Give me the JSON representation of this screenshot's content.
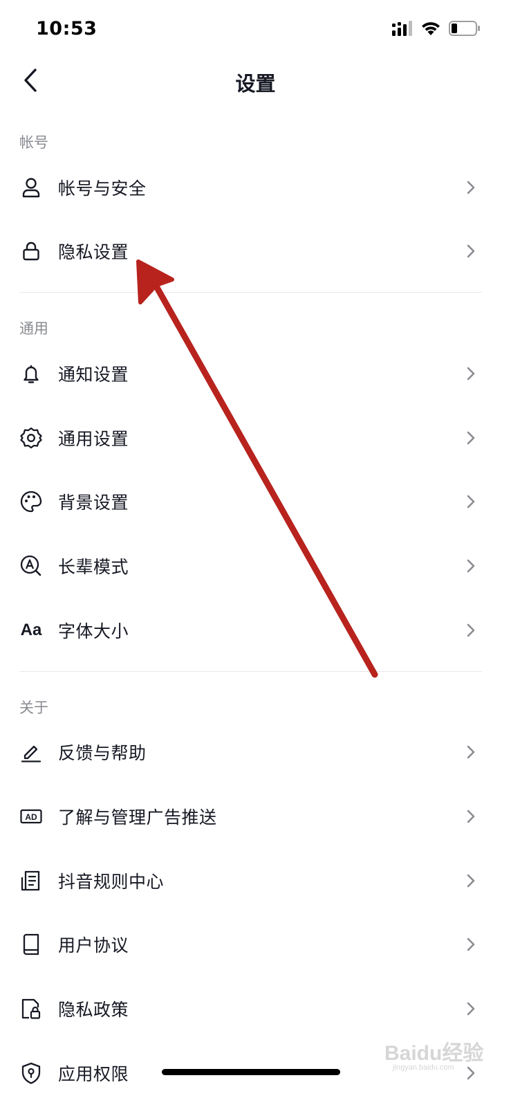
{
  "status_bar": {
    "time": "10:53",
    "signal_icon": "signal-icon",
    "wifi_icon": "wifi-icon",
    "battery_icon": "battery-icon"
  },
  "header": {
    "title": "设置",
    "back_icon": "back-chevron-icon"
  },
  "sections": [
    {
      "title": "帐号",
      "items": [
        {
          "label": "帐号与安全",
          "icon": "user-icon"
        },
        {
          "label": "隐私设置",
          "icon": "lock-icon"
        }
      ]
    },
    {
      "title": "通用",
      "items": [
        {
          "label": "通知设置",
          "icon": "bell-icon"
        },
        {
          "label": "通用设置",
          "icon": "gear-icon"
        },
        {
          "label": "背景设置",
          "icon": "palette-icon"
        },
        {
          "label": "长辈模式",
          "icon": "elder-mode-icon"
        },
        {
          "label": "字体大小",
          "icon": "font-size-icon",
          "icon_text": "Aa"
        }
      ]
    },
    {
      "title": "关于",
      "items": [
        {
          "label": "反馈与帮助",
          "icon": "pencil-icon"
        },
        {
          "label": "了解与管理广告推送",
          "icon": "ad-icon",
          "icon_text": "AD"
        },
        {
          "label": "抖音规则中心",
          "icon": "document-icon"
        },
        {
          "label": "用户协议",
          "icon": "book-icon"
        },
        {
          "label": "隐私政策",
          "icon": "privacy-doc-icon"
        },
        {
          "label": "应用权限",
          "icon": "shield-icon"
        }
      ]
    }
  ],
  "annotation": {
    "color": "#b8231e"
  },
  "watermark": {
    "brand": "Baidu经验",
    "url": "jingyan.baidu.com"
  },
  "colors": {
    "text": "#161823",
    "secondary": "#8a8b91",
    "chevron": "#8a8b91",
    "divider": "#e8e8e8"
  }
}
